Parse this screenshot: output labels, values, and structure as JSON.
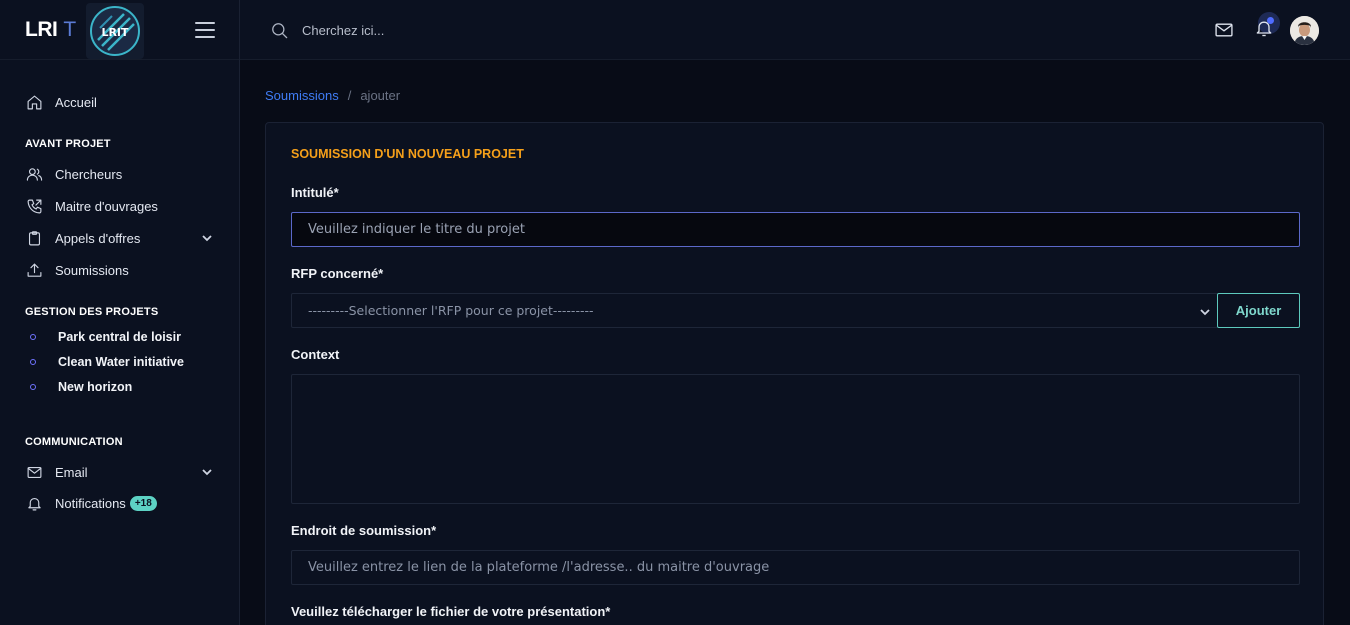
{
  "brand": {
    "name": "LRI",
    "suffix": "T",
    "badge_text": "LRIT"
  },
  "sidebar": {
    "home": "Accueil",
    "sections": {
      "avant_projet": "AVANT PROJET",
      "gestion": "GESTION DES PROJETS",
      "communication": "COMMUNICATION"
    },
    "avant_items": [
      {
        "label": "Chercheurs",
        "icon": "users-icon"
      },
      {
        "label": "Maitre d'ouvrages",
        "icon": "phone-icon"
      },
      {
        "label": "Appels d'offres",
        "icon": "clipboard-icon"
      },
      {
        "label": "Soumissions",
        "icon": "upload-icon"
      }
    ],
    "projects": [
      "Park central de loisir",
      "Clean Water initiative",
      "New horizon"
    ],
    "email": "Email",
    "notifications": "Notifications",
    "notifications_badge": "+18"
  },
  "topbar": {
    "search_placeholder": "Cherchez ici..."
  },
  "breadcrumb": {
    "parent": "Soumissions",
    "separator": "/",
    "current": "ajouter"
  },
  "form": {
    "title": "SOUMISSION D'UN NOUVEAU PROJET",
    "intitule_label": "Intitulé*",
    "intitule_placeholder": "Veuillez indiquer le titre du projet",
    "rfp_label": "RFP concerné*",
    "rfp_selected": "---------Selectionner l'RFP pour ce projet---------",
    "add_button": "Ajouter",
    "context_label": "Context",
    "endroit_label": "Endroit de soumission*",
    "endroit_placeholder": "Veuillez entrez le lien de la plateforme /l'adresse.. du maitre d'ouvrage",
    "fichier_label": "Veuillez télécharger le fichier de votre présentation*"
  },
  "colors": {
    "accent_orange": "#f6a01a",
    "link_blue": "#3f7cf5",
    "teal": "#5dc9bd",
    "background": "#080c17"
  }
}
